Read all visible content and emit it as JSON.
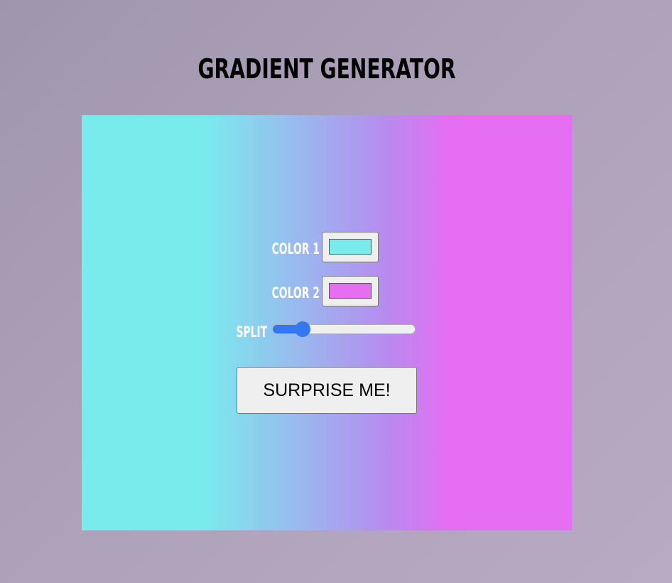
{
  "header": {
    "title": "GRADIENT GENERATOR"
  },
  "controls": {
    "color1": {
      "label": "COLOR 1",
      "value": "#7aebed"
    },
    "color2": {
      "label": "COLOR 2",
      "value": "#e66ef2"
    },
    "split": {
      "label": "SPLIT",
      "value_fraction": 0.18
    },
    "surprise_label": "SURPRISE ME!"
  },
  "colors": {
    "slider_accent": "#3477f0",
    "page_background_start": "#9f96ad",
    "page_background_end": "#b9aac3"
  },
  "icons": {
    "color_picker": "color-swatch",
    "slider_thumb": "circle-thumb"
  }
}
